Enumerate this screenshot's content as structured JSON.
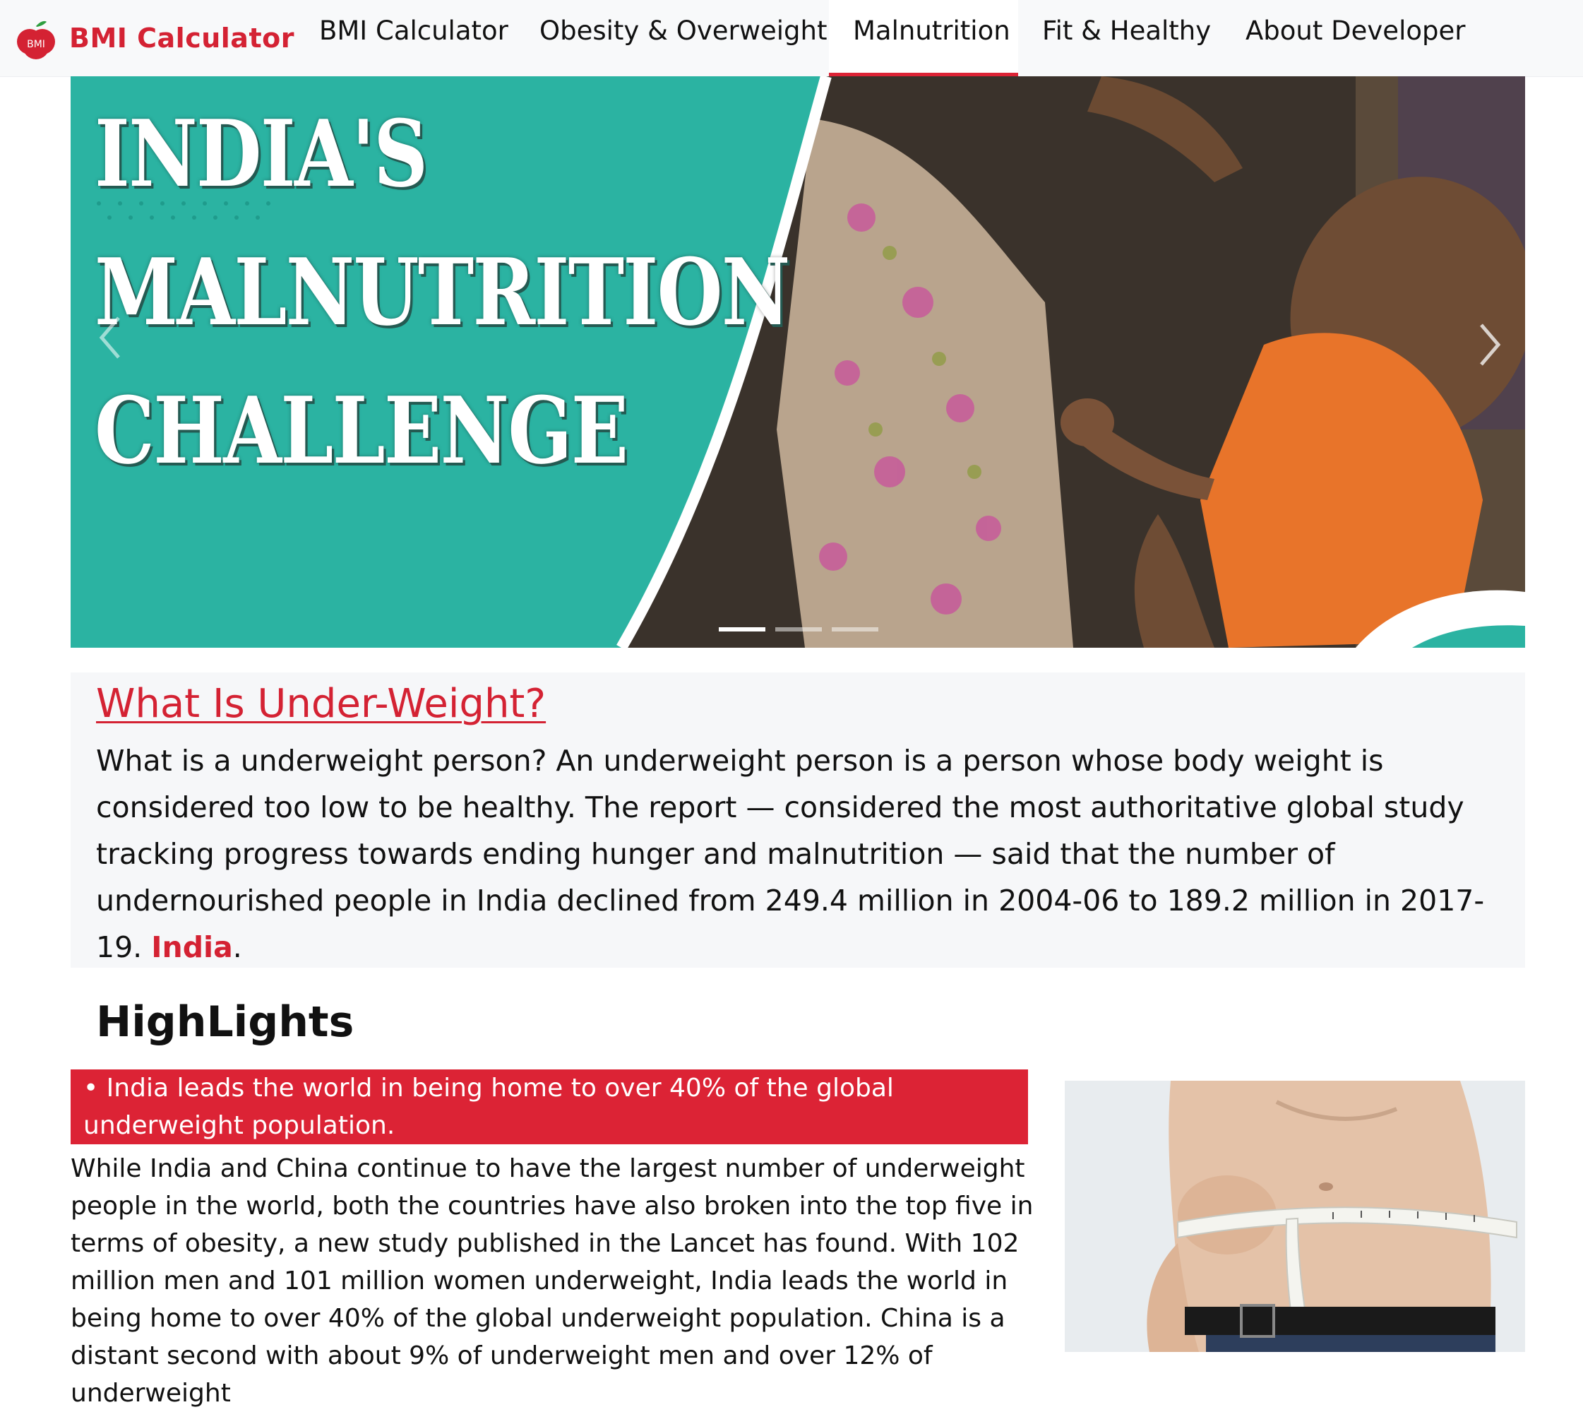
{
  "brand": {
    "logo_text": "BMI",
    "name": "BMI Calculator",
    "color": "#d42233"
  },
  "nav": {
    "items": [
      {
        "label": "BMI Calculator"
      },
      {
        "label": "Obesity & Overweight"
      },
      {
        "label": "Malnutrition"
      },
      {
        "label": "Fit & Healthy"
      },
      {
        "label": "About Developer"
      }
    ],
    "active": "Malnutrition"
  },
  "hero": {
    "title_lines": [
      "INDIA'S",
      "MALNUTRITION",
      "CHALLENGE"
    ],
    "slide_count": 3,
    "active_slide": 1,
    "accent_color": "#2bb3a2",
    "prev_icon": "chevron-left-icon",
    "next_icon": "chevron-right-icon"
  },
  "underweight": {
    "heading": "What Is Under-Weight?",
    "text": "What is a underweight person? An underweight person is a person whose body weight is considered too low to be healthy. The report — considered the most authoritative global study tracking progress towards ending hunger and malnutrition — said that the number of undernourished people in India declined from 249.4 million in 2004-06 to 189.2 million in 2017-19.",
    "highlight_word": "India",
    "trailing": "."
  },
  "highlights": {
    "heading": "HighLights",
    "banner": "• India leads the world in being home to over 40% of the global underweight population.",
    "text": "While India and China continue to have the largest number of underweight people in the world, both the countries have also broken into the top five in terms of obesity, a new study published in the Lancet has found. With 102 million men and 101 million women underweight, India leads the world in being home to over 40% of the global underweight population. China is a distant second with about 9% of underweight men and over 12% of underweight"
  },
  "colors": {
    "red": "#dc2335",
    "teal": "#2bb3a2",
    "nav_bg": "#f8f9fa"
  }
}
